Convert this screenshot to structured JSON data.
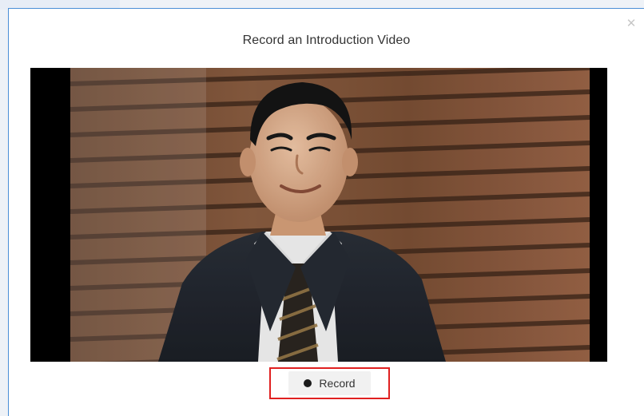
{
  "modal": {
    "title": "Record an Introduction Video",
    "close_glyph": "✕"
  },
  "video": {
    "preview_description": "webcam-preview"
  },
  "controls": {
    "record_label": "Record",
    "record_icon": "record-dot-icon"
  },
  "colors": {
    "highlight": "#e02020",
    "modal_border": "#4a8fd6",
    "button_bg": "#f1f1f1"
  }
}
